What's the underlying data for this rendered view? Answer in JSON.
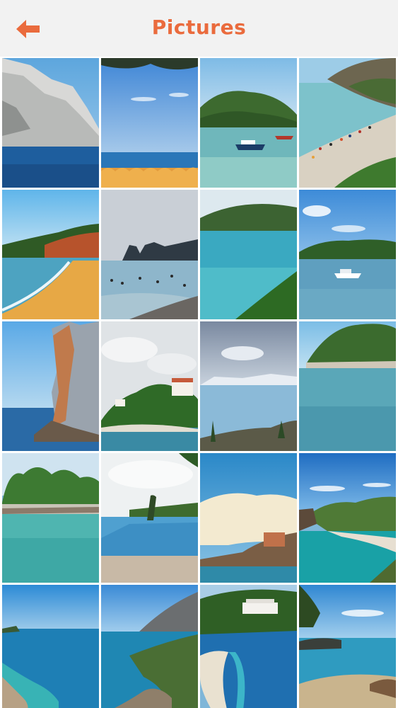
{
  "header": {
    "title": "Pictures",
    "back_icon": "back-arrow-icon"
  },
  "colors": {
    "accent": "#ea6b3d",
    "header_bg": "#f2f2f2"
  },
  "gallery": {
    "columns": 4,
    "rows": 5,
    "photos": [
      "white-cliff-sea-photo",
      "beach-umbrellas-photo",
      "boat-bay-photo",
      "crowded-beach-photo",
      "golden-beach-cliff-photo",
      "swimmers-rock-arch-photo",
      "turquoise-bay-photo",
      "harbor-boat-photo",
      "tall-sea-rock-photo",
      "island-village-photo",
      "cloudy-sea-view-photo",
      "forested-headland-photo",
      "pine-beach-loungers-photo",
      "infinity-pool-photo",
      "hilltop-town-sky-photo",
      "green-cape-cove-photo",
      "turquoise-coastline-photo",
      "mountain-coast-photo",
      "hotel-bay-beach-photo",
      "rocky-shore-tree-photo"
    ]
  }
}
